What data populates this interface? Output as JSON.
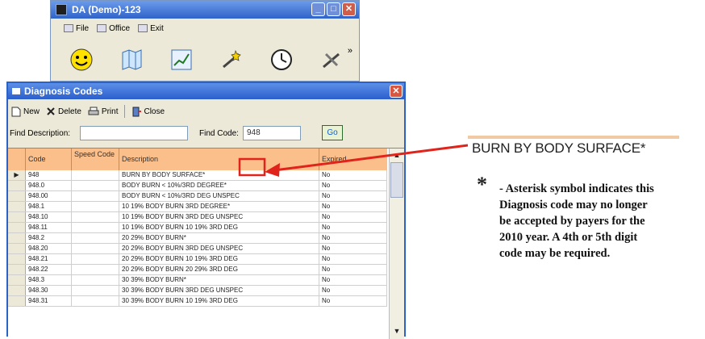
{
  "small_window": {
    "title": "DA (Demo)-123",
    "menu": [
      "File",
      "Office",
      "Exit"
    ],
    "chevron": "»"
  },
  "dialog": {
    "title": "Diagnosis Codes",
    "toolbar": {
      "new": "New",
      "delete": "Delete",
      "print": "Print",
      "close": "Close"
    },
    "find_description_label": "Find Description:",
    "find_description_value": "",
    "find_code_label": "Find Code:",
    "find_code_value": "948",
    "go_label": "Go"
  },
  "grid": {
    "columns": [
      "Code",
      "Speed Code",
      "Description",
      "Expired"
    ],
    "rows": [
      {
        "code": "948",
        "speed": "",
        "desc": "BURN BY BODY SURFACE*",
        "expired": "No"
      },
      {
        "code": "948.0",
        "speed": "",
        "desc": "BODY BURN < 10%/3RD DEGREE*",
        "expired": "No"
      },
      {
        "code": "948.00",
        "speed": "",
        "desc": "BODY BURN < 10%/3RD DEG UNSPEC",
        "expired": "No"
      },
      {
        "code": "948.1",
        "speed": "",
        "desc": "10 19% BODY BURN 3RD DEGREE*",
        "expired": "No"
      },
      {
        "code": "948.10",
        "speed": "",
        "desc": "10 19% BODY BURN 3RD DEG UNSPEC",
        "expired": "No"
      },
      {
        "code": "948.11",
        "speed": "",
        "desc": "10 19% BODY BURN 10 19% 3RD DEG",
        "expired": "No"
      },
      {
        "code": "948.2",
        "speed": "",
        "desc": "20 29% BODY BURN*",
        "expired": "No"
      },
      {
        "code": "948.20",
        "speed": "",
        "desc": "20 29% BODY BURN 3RD DEG UNSPEC",
        "expired": "No"
      },
      {
        "code": "948.21",
        "speed": "",
        "desc": "20 29% BODY BURN 10 19% 3RD DEG",
        "expired": "No"
      },
      {
        "code": "948.22",
        "speed": "",
        "desc": "20 29% BODY BURN 20 29% 3RD DEG",
        "expired": "No"
      },
      {
        "code": "948.3",
        "speed": "",
        "desc": "30 39% BODY BURN*",
        "expired": "No"
      },
      {
        "code": "948.30",
        "speed": "",
        "desc": "30 39% BODY BURN 3RD DEG UNSPEC",
        "expired": "No"
      },
      {
        "code": "948.31",
        "speed": "",
        "desc": "30 39% BODY BURN 10 19% 3RD DEG",
        "expired": "No"
      }
    ]
  },
  "callout": {
    "cutout_text": "BURN BY BODY SURFACE*",
    "asterisk": "*",
    "note_line1": "- Asterisk symbol indicates this",
    "note_line2": "Diagnosis code may no longer",
    "note_line3": "be accepted by payers for the",
    "note_line4": "2010 year. A 4th or 5th digit",
    "note_line5": "code may be required."
  },
  "colors": {
    "highlight": "#e0241b",
    "header": "#fbbf8c",
    "title_bar": "#2a5fcd"
  }
}
